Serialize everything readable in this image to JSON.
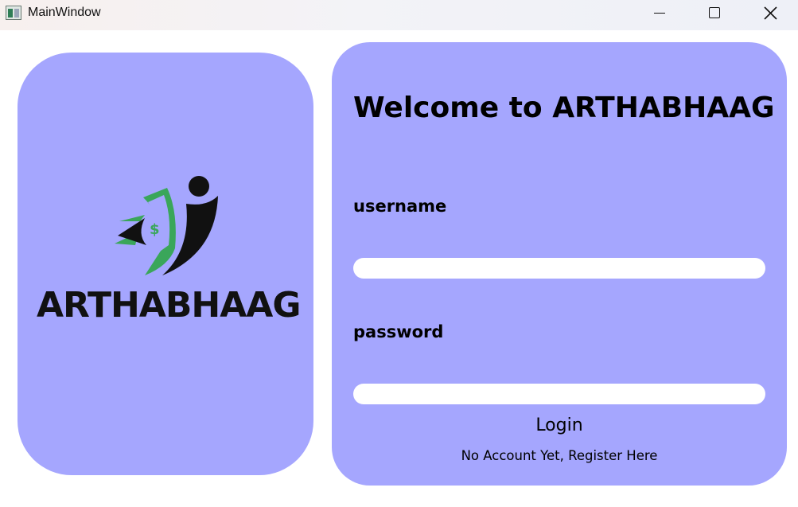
{
  "window": {
    "title": "MainWindow",
    "icon": "app-icon",
    "controls": [
      "minimize-icon",
      "maximize-icon",
      "close-icon"
    ]
  },
  "brand": {
    "logo_text": "ARTHABHAAG",
    "logo_icon": "money-flying-figure-icon",
    "colors": {
      "card_bg": "#a5a6fe",
      "logo_green": "#3aa65a",
      "logo_black": "#111111"
    }
  },
  "login_form": {
    "heading": "Welcome to ARTHABHAAG",
    "username_label": "username",
    "username_value": "",
    "password_label": "password",
    "password_value": "",
    "login_label": "Login",
    "register_label": "No Account Yet, Register Here"
  }
}
